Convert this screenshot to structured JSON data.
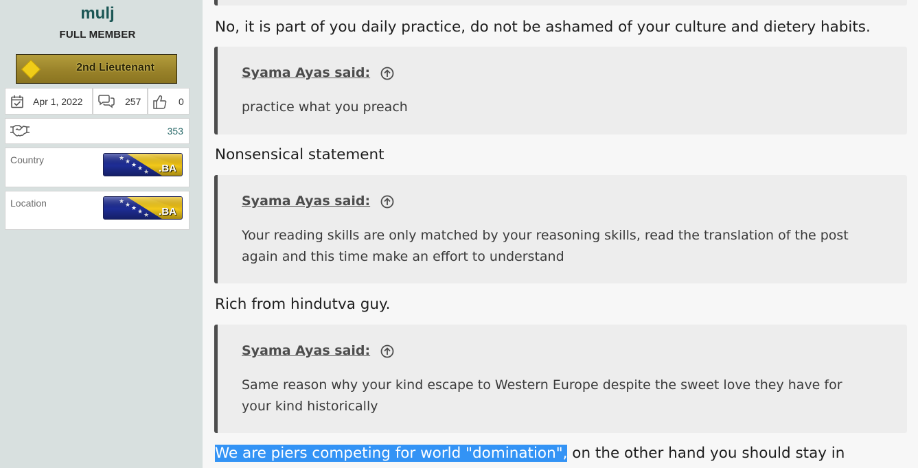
{
  "sidebar": {
    "username": "mulj",
    "user_title": "FULL MEMBER",
    "rank": "2nd Lieutenant",
    "joined": "Apr 1, 2022",
    "messages": "257",
    "reactions": "0",
    "points": "353",
    "country_label": "Country",
    "location_label": "Location",
    "flag_text": ".BA",
    "icons": [
      "calendar-check-icon",
      "speech-bubbles-icon",
      "thumbs-up-icon",
      "handshake-icon"
    ]
  },
  "content": {
    "reply_1": "No, it is part of you daily practice, do not be ashamed of your culture and dietery habits.",
    "quotes": [
      {
        "author": "Syama Ayas said:",
        "line1": "practice what you preach",
        "line2": ""
      },
      {
        "author": "Syama Ayas said:",
        "line1": "Your reading skills are only matched by your reasoning skills, read the translation of the post",
        "line2": "again and this time make an effort to understand"
      },
      {
        "author": "Syama Ayas said:",
        "line1": "Same reason why your kind escape to Western Europe despite the sweet love they have for",
        "line2": "your kind historically"
      }
    ],
    "reply_2": "Nonsensical statement",
    "reply_3": "Rich from hindutva guy.",
    "reply_4_selected": "We are piers competing for world \"domination\",",
    "reply_4_rest": " on the other hand you should stay in"
  },
  "colors": {
    "sidebar_bg": "#d8e0df",
    "username": "#1a5654",
    "quote_bg": "#ededed",
    "quote_border": "#4d4d4d",
    "selection": "#3393f5"
  }
}
